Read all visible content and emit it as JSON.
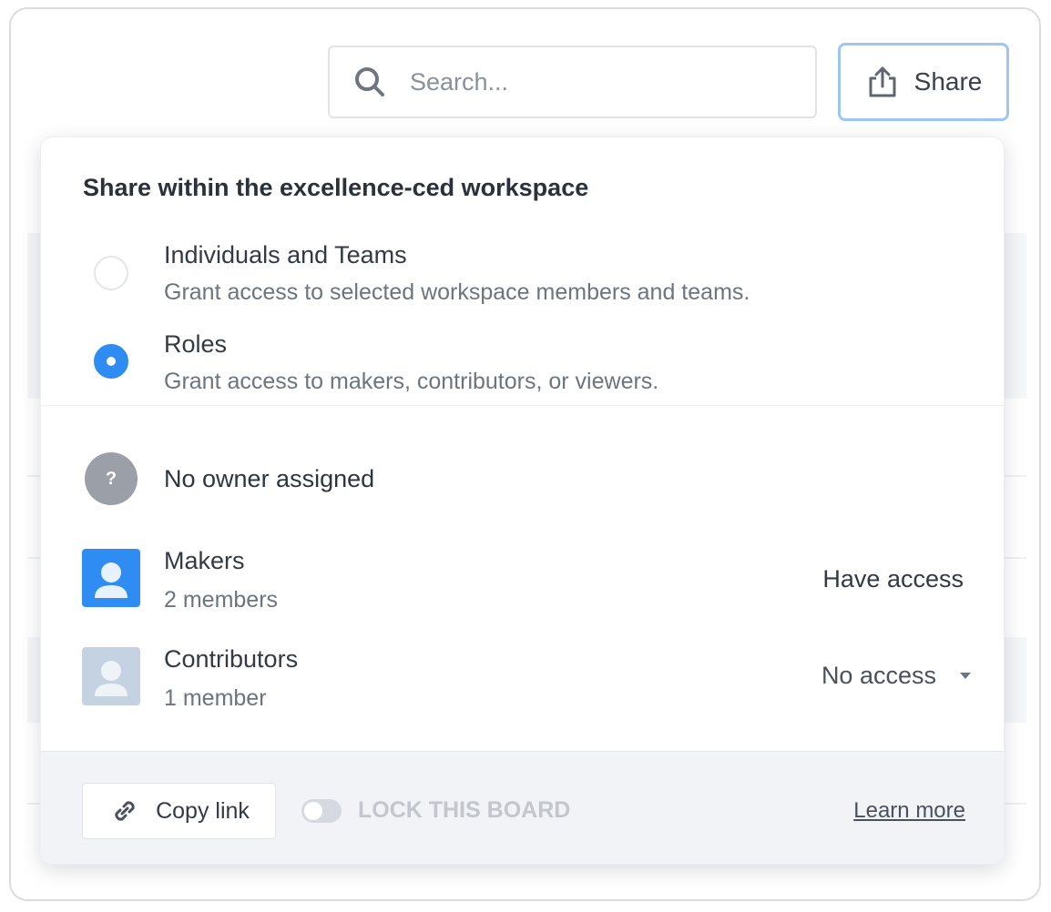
{
  "toolbar": {
    "search_placeholder": "Search...",
    "share_label": "Share"
  },
  "share_popover": {
    "title": "Share within the excellence-ced workspace",
    "options": [
      {
        "label": "Individuals and Teams",
        "description": "Grant access to selected workspace members and teams.",
        "selected": false
      },
      {
        "label": "Roles",
        "description": "Grant access to makers, contributors, or viewers.",
        "selected": true
      }
    ],
    "owner": {
      "avatar_glyph": "?",
      "text": "No owner assigned"
    },
    "roles": [
      {
        "name": "Makers",
        "count": "2 members",
        "access": "Have access",
        "icon": "user-avatar-icon",
        "color": "#2f8cf3"
      },
      {
        "name": "Contributors",
        "count": "1 member",
        "access": "No access",
        "icon": "user-avatar-icon",
        "color": "#c4d2e2"
      }
    ],
    "footer": {
      "copy_link_label": "Copy link",
      "lock_label": "LOCK THIS BOARD",
      "lock_enabled": false,
      "learn_more_label": "Learn more"
    }
  },
  "colors": {
    "accent": "#2f8cf3",
    "share_border": "#9cc6f5",
    "footer_bg": "#f1f3f6"
  }
}
